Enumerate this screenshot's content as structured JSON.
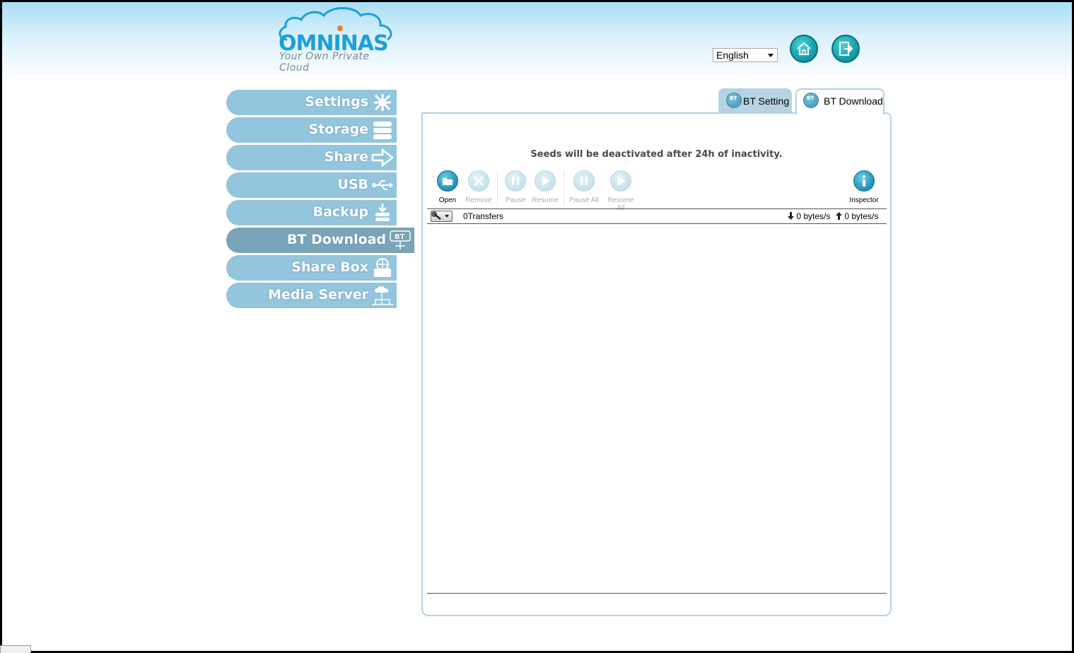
{
  "logo": {
    "brand": "OMNINAS",
    "tagline": "Your Own Private Cloud",
    "icon": "cloud-logo-icon"
  },
  "header": {
    "language": "English",
    "home_icon": "home-icon",
    "logout_icon": "logout-icon"
  },
  "sidebar": {
    "items": [
      {
        "label": "Settings",
        "icon": "settings-icon"
      },
      {
        "label": "Storage",
        "icon": "storage-icon"
      },
      {
        "label": "Share",
        "icon": "share-arrow-icon"
      },
      {
        "label": "USB",
        "icon": "usb-icon"
      },
      {
        "label": "Backup",
        "icon": "backup-icon"
      },
      {
        "label": "BT Download",
        "icon": "bt-icon",
        "badge": "BT",
        "active": true
      },
      {
        "label": "Share Box",
        "icon": "share-box-icon"
      },
      {
        "label": "Media Server",
        "icon": "media-server-icon"
      }
    ]
  },
  "tabs": [
    {
      "label": "BT Setting",
      "icon_text": "BT"
    },
    {
      "label": "BT Download",
      "icon_text": "BT",
      "active": true
    }
  ],
  "main": {
    "notice": "Seeds will be deactivated after 24h of inactivity.",
    "toolbar": {
      "open": "Open",
      "remove": "Remove",
      "pause": "Pause",
      "resume": "Resume",
      "pause_all": "Pause All",
      "resume_all": "Resume All",
      "inspector": "Inspector"
    },
    "status": {
      "transfers": "0Transfers",
      "download_speed": "0 bytes/s",
      "upload_speed": "0 bytes/s"
    }
  },
  "colors": {
    "accent": "#1d9fd9",
    "nav": "#93c5dc",
    "nav_active": "#7aa4b8",
    "tab_border": "#b5d3e2"
  }
}
